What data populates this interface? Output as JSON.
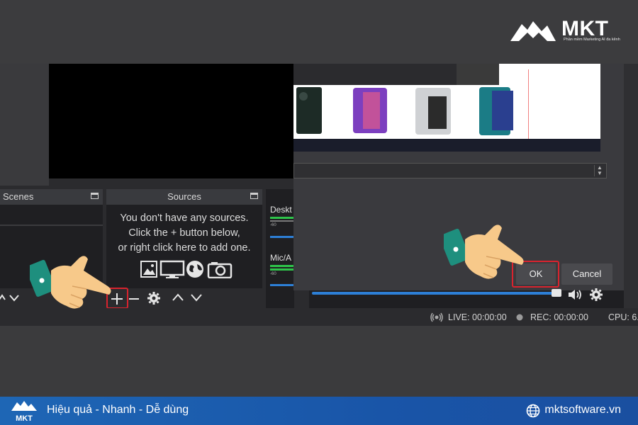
{
  "brand": {
    "name": "MKT",
    "tagline": "Phần mềm Marketing AI đa kênh",
    "accent": "#d9232e",
    "bar_color": "#1e66b5"
  },
  "obs": {
    "scenes": {
      "title": "Scenes"
    },
    "sources": {
      "title": "Sources",
      "empty_lines": [
        "You don't have any sources.",
        "Click the + button below,",
        "or right click here to add one."
      ],
      "icons": [
        "image-icon",
        "display-icon",
        "globe-icon",
        "camera-icon"
      ]
    },
    "mixer": {
      "channels": [
        {
          "label": "Deskt",
          "db": "-60"
        },
        {
          "label": "Mic/A",
          "db": "-60"
        }
      ]
    },
    "dialog": {
      "ok_label": "OK",
      "cancel_label": "Cancel"
    },
    "status": {
      "live": "LIVE: 00:00:00",
      "rec": "REC: 00:00:00",
      "cpu": "CPU: 6."
    }
  },
  "footer": {
    "slogan": "Hiệu quả - Nhanh - Dễ dùng",
    "website": "mktsoftware.vn"
  }
}
